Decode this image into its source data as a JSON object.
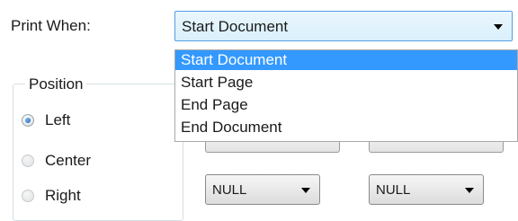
{
  "print_when": {
    "label": "Print When:",
    "value": "Start Document",
    "options": [
      "Start Document",
      "Start Page",
      "End Page",
      "End Document"
    ],
    "highlighted_index": 0
  },
  "position": {
    "title": "Position",
    "options": [
      {
        "label": "Left",
        "checked": true
      },
      {
        "label": "Center",
        "checked": false
      },
      {
        "label": "Right",
        "checked": false
      }
    ]
  },
  "nulls": {
    "left": "NULL",
    "right": "NULL"
  },
  "icons": {
    "combo_arrow": "chevron-down-icon",
    "null_arrow": "chevron-down-icon"
  },
  "colors": {
    "highlight": "#3399ff",
    "focus_border": "#569de5"
  }
}
